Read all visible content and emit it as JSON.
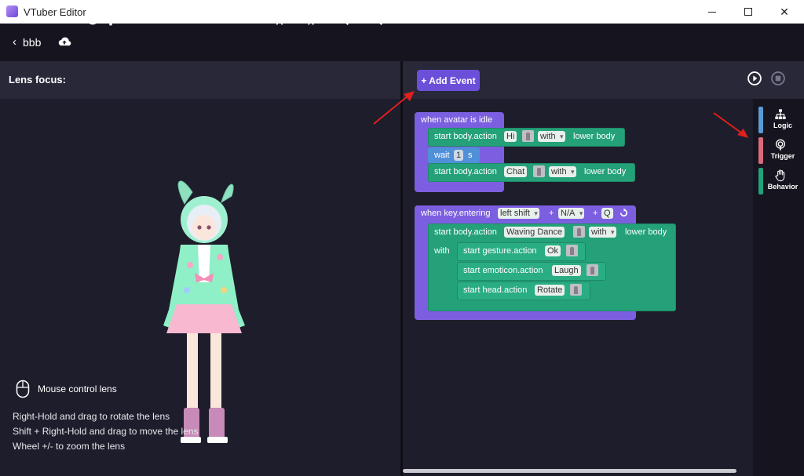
{
  "window": {
    "title": "VTuber Editor"
  },
  "nav": {
    "back_label": "bbb"
  },
  "left_panel": {
    "lens_focus_label": "Lens focus:",
    "hints": {
      "mouse_title": "Mouse control lens",
      "rotate": "Right-Hold and drag to rotate the lens",
      "move": "Shift + Right-Hold and drag to move the lens",
      "zoom": "Wheel +/- to zoom the lens"
    }
  },
  "right_panel": {
    "add_event_label": "+ Add Event",
    "categories": [
      {
        "label": "Logic",
        "color": "#5b9bd5",
        "icon": "logic-tree-icon"
      },
      {
        "label": "Trigger",
        "color": "#d96b7a",
        "icon": "trigger-icon"
      },
      {
        "label": "Behavior",
        "color": "#24a179",
        "icon": "hand-icon"
      }
    ]
  },
  "event1": {
    "header": "when avatar is idle",
    "b1": {
      "prefix": "start body.action",
      "action": "Hi",
      "with": "with",
      "suffix": "lower body"
    },
    "wait": {
      "label": "wait",
      "value": "1",
      "unit": "s"
    },
    "b2": {
      "prefix": "start body.action",
      "action": "Chat",
      "with": "with",
      "suffix": "lower body"
    }
  },
  "event2": {
    "header": "when key.entering",
    "key1": "left shift",
    "plus1": "+",
    "key2": "N/A",
    "plus2": "+",
    "key3": "Q",
    "body": {
      "prefix": "start body.action",
      "action": "Waving Dance",
      "with": "with",
      "suffix": "lower body"
    },
    "with_label": "with",
    "gesture": {
      "prefix": "start gesture.action",
      "action": "Ok"
    },
    "emoticon": {
      "prefix": "start emoticon.action",
      "action": "Laugh"
    },
    "head": {
      "prefix": "start head.action",
      "action": "Rotate"
    }
  },
  "colors": {
    "event_purple": "#7c5fe0",
    "action_green": "#24a179",
    "wait_blue": "#4f90d9",
    "accent": "#6c4fd9"
  }
}
